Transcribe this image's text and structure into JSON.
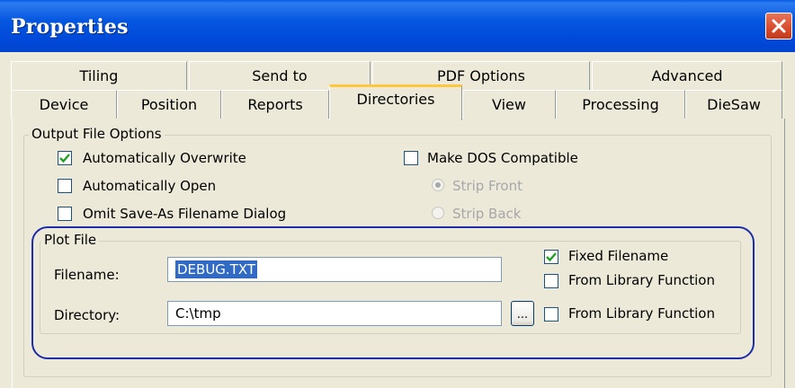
{
  "window": {
    "title": "Properties"
  },
  "tabs": {
    "top_row": [
      "Tiling",
      "Send to",
      "PDF Options",
      "Advanced"
    ],
    "bottom_row": [
      "Device",
      "Position",
      "Reports",
      "Directories",
      "View",
      "Processing",
      "DieSaw"
    ],
    "active": "Directories"
  },
  "output_options": {
    "legend": "Output File Options",
    "auto_overwrite": {
      "label": "Automatically Overwrite",
      "checked": true
    },
    "auto_open": {
      "label": "Automatically Open",
      "checked": false
    },
    "omit_saveas": {
      "label": "Omit Save-As Filename Dialog",
      "checked": false
    },
    "dos_compat": {
      "label": "Make DOS Compatible",
      "checked": false
    },
    "strip_front": {
      "label": "Strip Front",
      "selected": true,
      "disabled": true
    },
    "strip_back": {
      "label": "Strip Back",
      "selected": false,
      "disabled": true
    }
  },
  "plot_file": {
    "legend": "Plot File",
    "filename_label": "Filename:",
    "filename_value": "DEBUG.TXT",
    "directory_label": "Directory:",
    "directory_value": "C:\\tmp",
    "browse_label": "...",
    "fixed_filename": {
      "label": "Fixed Filename",
      "checked": true
    },
    "from_library_1": {
      "label": "From Library Function",
      "checked": false
    },
    "from_library_2": {
      "label": "From Library Function",
      "checked": false
    }
  },
  "colors": {
    "titlebar": "#0054E3",
    "dialog_bg": "#ECE9D8",
    "highlight_ring": "#1E2DA8"
  }
}
